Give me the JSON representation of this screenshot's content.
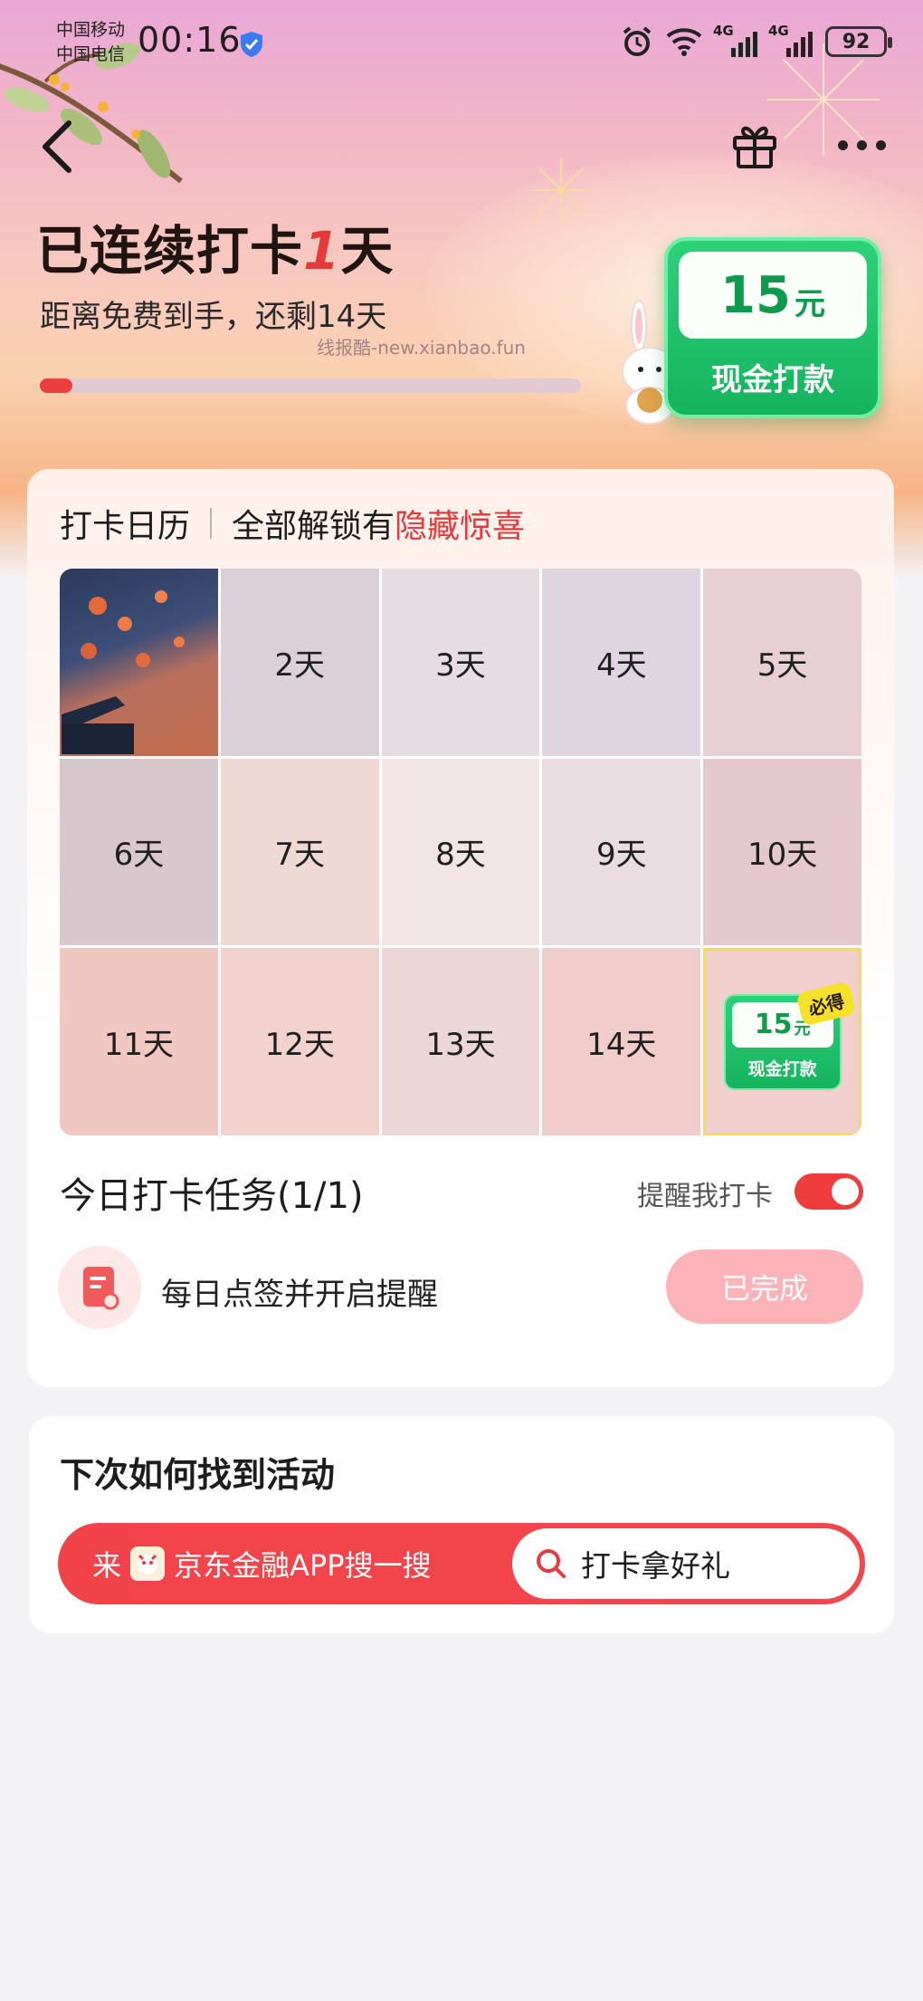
{
  "status_bar": {
    "carrier_1": "中国移动",
    "carrier_2": "中国电信",
    "time": "00:16",
    "network_1": "4G",
    "network_2": "4G",
    "battery": "92"
  },
  "header": {
    "headline_prefix": "已连续打卡",
    "streak_days": "1",
    "headline_suffix": "天",
    "subline": "距离免费到手，还剩14天",
    "watermark": "线报酷-new.xianbao.fun",
    "progress": 0.06
  },
  "reward_card": {
    "amount": "15",
    "unit": "元",
    "label": "现金打款"
  },
  "calendar": {
    "title": "打卡日历",
    "hint_prefix": "全部解锁有",
    "hint_highlight": "隐藏惊喜",
    "days": [
      "2天",
      "3天",
      "4天",
      "5天",
      "6天",
      "7天",
      "8天",
      "9天",
      "10天",
      "11天",
      "12天",
      "13天",
      "14天"
    ],
    "final_reward": {
      "amount": "15",
      "unit": "元",
      "label": "现金打款",
      "badge": "必得"
    }
  },
  "task": {
    "title": "今日打卡任务(1/1)",
    "remind_label": "提醒我打卡",
    "remind_on": true,
    "item_text": "每日点签并开启提醒",
    "done_label": "已完成"
  },
  "find": {
    "title": "下次如何找到活动",
    "prefix": "来",
    "app_text": "京东金融APP搜一搜",
    "keyword": "打卡拿好礼"
  },
  "colors": {
    "accent_red": "#ef3c3c",
    "reward_green": "#16b35e",
    "done_pink": "#fdb4b8"
  }
}
